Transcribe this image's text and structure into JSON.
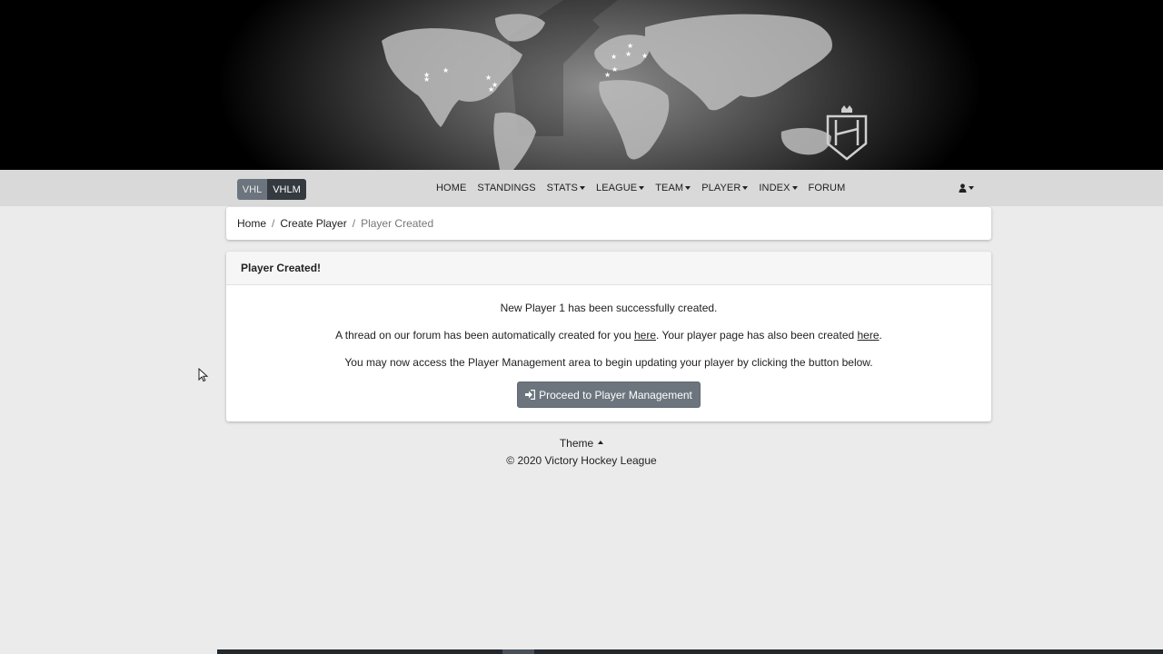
{
  "banner": {
    "logo_icon": "vhl-shield-crown-logo"
  },
  "league_toggle": {
    "vhl": "VHL",
    "vhlm": "VHLM"
  },
  "nav": {
    "home": "HOME",
    "standings": "STANDINGS",
    "stats": "STATS",
    "league": "LEAGUE",
    "team": "TEAM",
    "player": "PLAYER",
    "index": "INDEX",
    "forum": "FORUM",
    "user_icon": "user-icon"
  },
  "breadcrumb": {
    "home": "Home",
    "create_player": "Create Player",
    "current": "Player Created",
    "separator": "/"
  },
  "card": {
    "title": "Player Created!",
    "line1": "New Player 1 has been successfully created.",
    "line2_pre": "A thread on our forum has been automatically created for you ",
    "line2_link1": "here",
    "line2_mid": ". Your player page has also been created ",
    "line2_link2": "here",
    "line2_post": ".",
    "line3": "You may now access the Player Management area to begin updating your player by clicking the button below.",
    "button": "Proceed to Player Management",
    "button_icon": "sign-in-icon"
  },
  "footer": {
    "theme": "Theme",
    "copyright": "© 2020 Victory Hockey League"
  },
  "colors": {
    "page_bg": "#ebebeb",
    "navbar_bg": "#d9d9d9",
    "button_bg": "#6c757d",
    "vhlm_bg": "#343a40"
  }
}
